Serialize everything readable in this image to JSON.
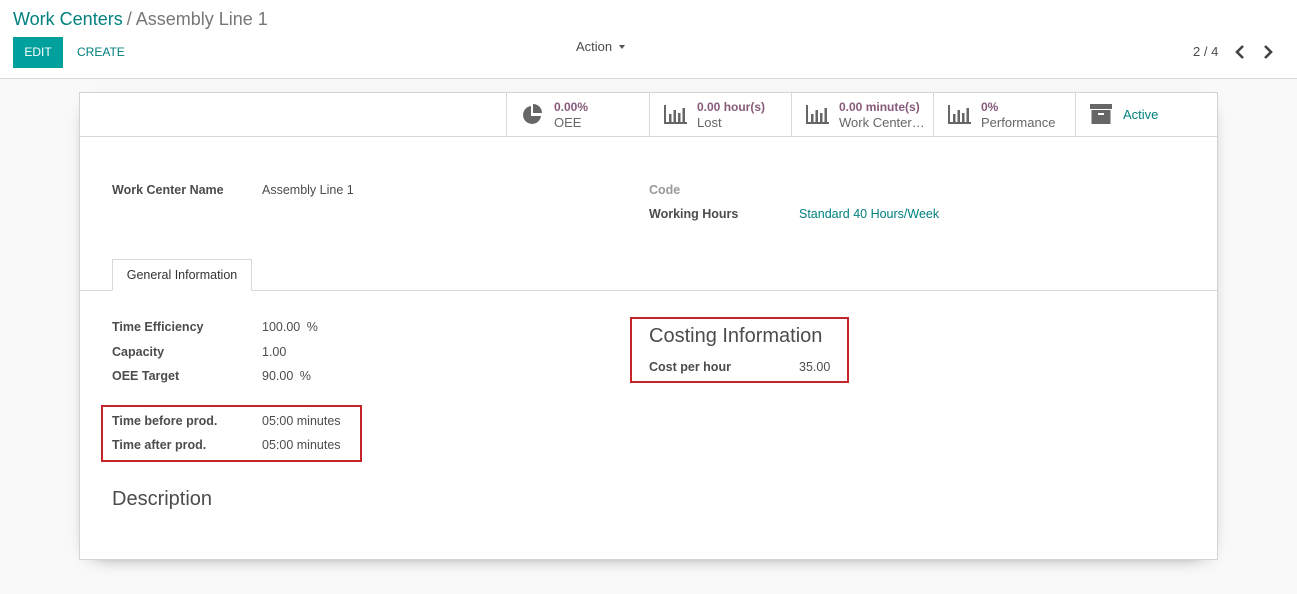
{
  "breadcrumb": {
    "parent": "Work Centers",
    "separator": "/",
    "current": "Assembly Line 1"
  },
  "toolbar": {
    "edit_label": "EDIT",
    "create_label": "CREATE",
    "action_label": "Action"
  },
  "pager": {
    "text": "2 / 4"
  },
  "stats": [
    {
      "value": "0.00%",
      "label": "OEE",
      "icon": "pie-chart-icon"
    },
    {
      "value": "0.00 hour(s)",
      "label": "Lost",
      "icon": "bar-chart-icon"
    },
    {
      "value": "0.00 minute(s)",
      "label": "Work Center…",
      "icon": "bar-chart-icon"
    },
    {
      "value": "0%",
      "label": "Performance",
      "icon": "bar-chart-icon"
    }
  ],
  "active_button": {
    "label": "Active",
    "icon": "archive-icon"
  },
  "fields": {
    "name_label": "Work Center Name",
    "name_value": "Assembly Line 1",
    "code_label": "Code",
    "hours_label": "Working Hours",
    "hours_value": "Standard 40 Hours/Week"
  },
  "tab": {
    "label": "General Information"
  },
  "general": {
    "efficiency_label": "Time Efficiency",
    "efficiency_value": "100.00",
    "efficiency_unit": "%",
    "capacity_label": "Capacity",
    "capacity_value": "1.00",
    "oee_label": "OEE Target",
    "oee_value": "90.00",
    "oee_unit": "%",
    "before_label": "Time before prod.",
    "before_value": "05:00 minutes",
    "after_label": "Time after prod.",
    "after_value": "05:00 minutes"
  },
  "costing": {
    "title": "Costing Information",
    "cost_label": "Cost per hour",
    "cost_value": "35.00"
  },
  "description": {
    "title": "Description"
  },
  "colors": {
    "accent": "#00a09d",
    "link": "#00807f",
    "stat_value": "#875a7b",
    "highlight_box": "#c7242a"
  }
}
